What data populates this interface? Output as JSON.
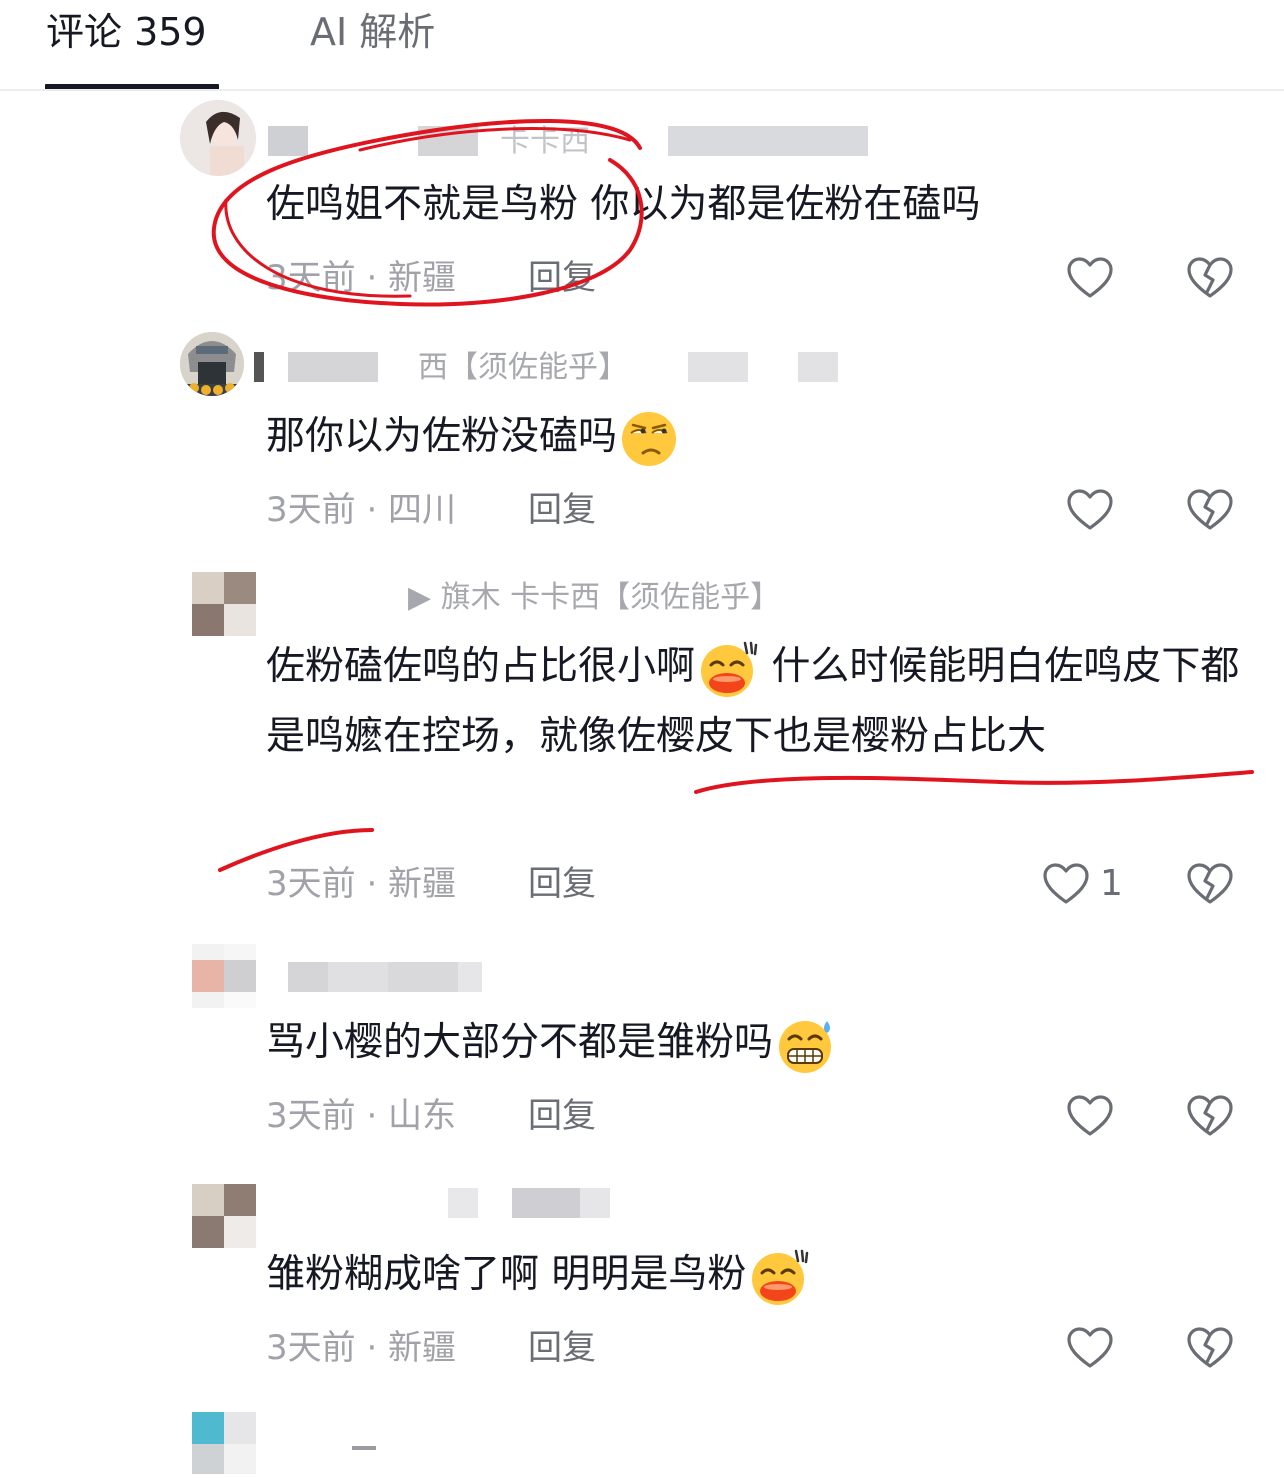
{
  "tabs": [
    {
      "label": "评论 359",
      "active": true
    },
    {
      "label": "AI 解析",
      "active": false
    }
  ],
  "comments": [
    {
      "username": "卡卡西",
      "content": "佐鸣姐不就是鸟粉 你以为都是佐粉在磕吗",
      "emoji": "",
      "meta": "3天前 · 新疆",
      "reply": "回复",
      "likes": ""
    },
    {
      "username": "西【须佐能乎】",
      "content": "那你以为佐粉没磕吗",
      "emoji": "rolling-eyes-emoji",
      "meta": "3天前 · 四川",
      "reply": "回复",
      "likes": ""
    },
    {
      "username": "▶ 旗木 卡卡西【须佐能乎】",
      "content": "佐粉磕佐鸣的占比很小啊",
      "content_after_emoji": " 什么时候能明白佐鸣皮下都是鸣嬷在控场，就像佐樱皮下也是樱粉占比大",
      "emoji": "smug-laugh-emoji",
      "meta": "3天前 · 新疆",
      "reply": "回复",
      "likes": "1"
    },
    {
      "username": "",
      "content": "骂小樱的大部分不都是雏粉吗",
      "emoji": "grin-sweat-emoji",
      "meta": "3天前 · 山东",
      "reply": "回复",
      "likes": ""
    },
    {
      "username": "",
      "content": "雏粉糊成啥了啊 明明是鸟粉",
      "emoji": "smug-laugh-emoji",
      "meta": "3天前 · 新疆",
      "reply": "回复",
      "likes": ""
    }
  ],
  "colors": {
    "primary_text": "#161823",
    "secondary_text": "#a1a2a9",
    "annotation_red": "#e0141e",
    "emoji_yellow": "#ffc83d"
  }
}
